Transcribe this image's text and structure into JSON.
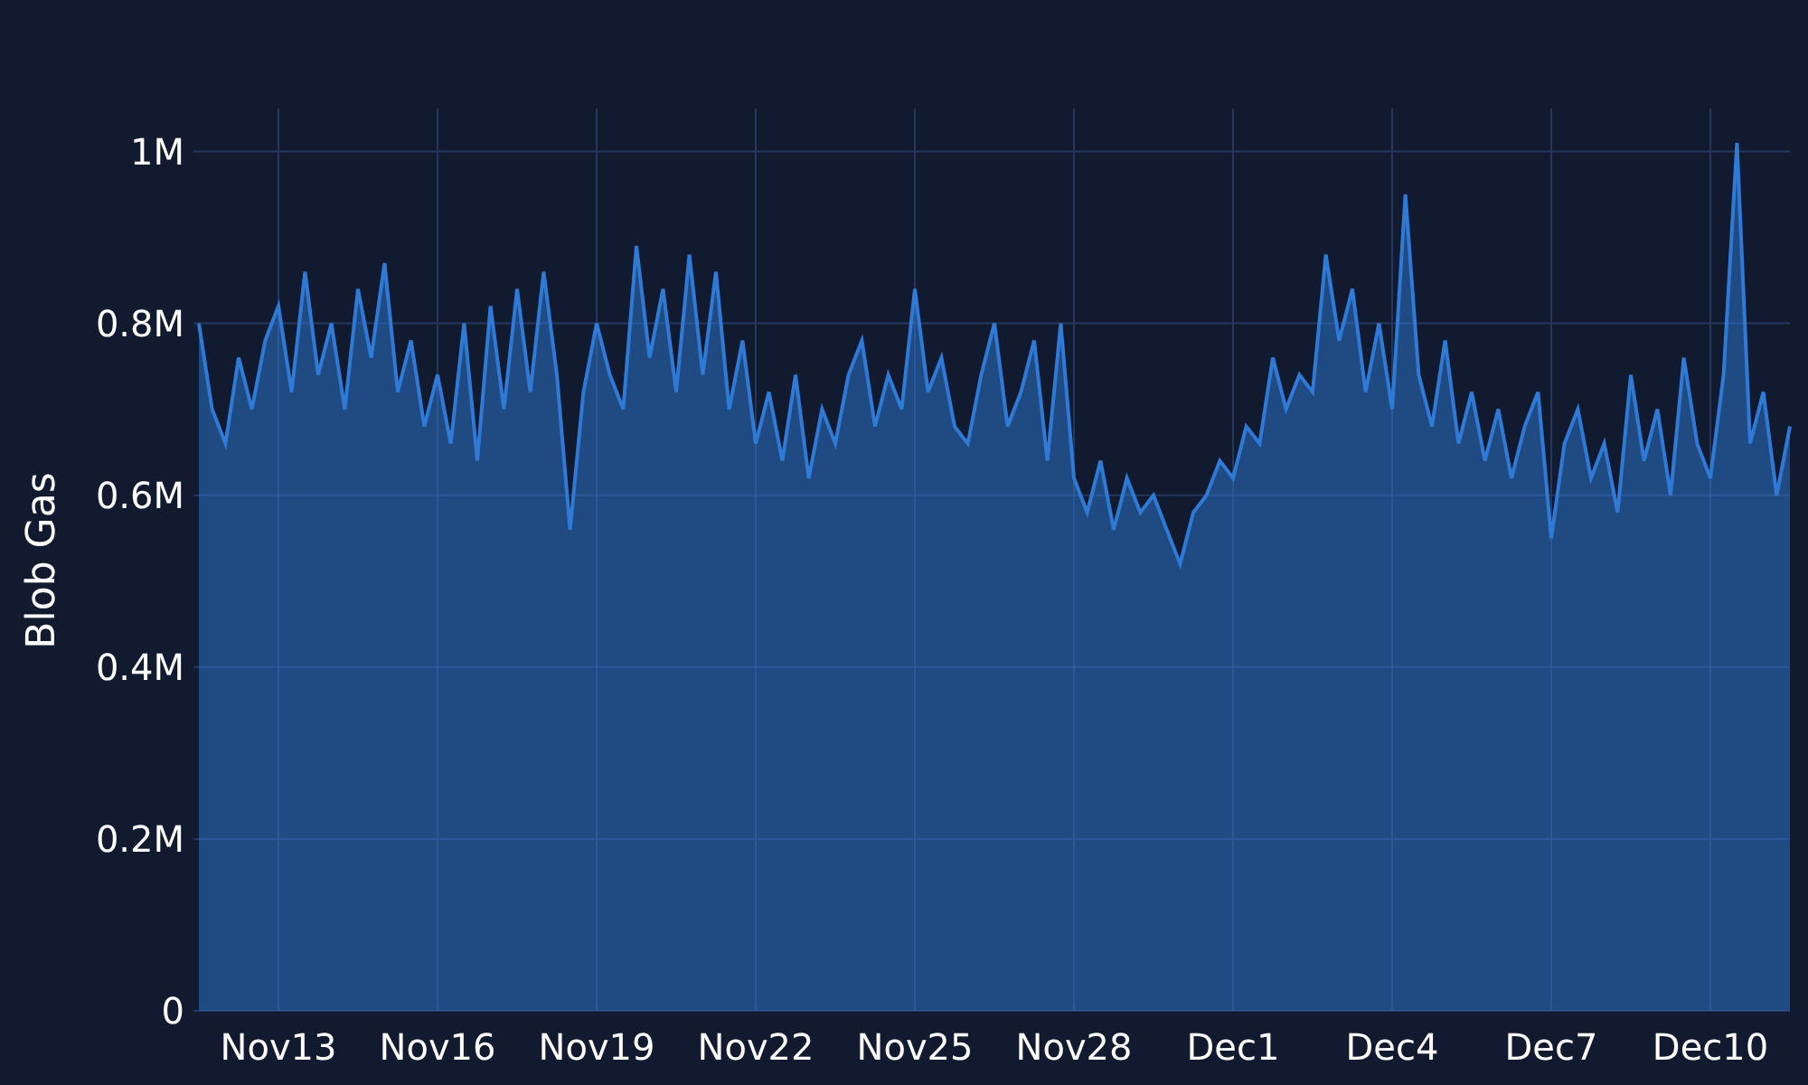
{
  "chart": {
    "chart_data": {
      "type": "area",
      "ylabel": "Blob Gas",
      "categories": [
        null,
        null,
        null,
        null,
        null,
        null,
        "Nov13",
        null,
        null,
        null,
        null,
        null,
        null,
        null,
        null,
        null,
        null,
        null,
        "Nov16",
        null,
        null,
        null,
        null,
        null,
        null,
        null,
        null,
        null,
        null,
        null,
        "Nov19",
        null,
        null,
        null,
        null,
        null,
        null,
        null,
        null,
        null,
        null,
        null,
        "Nov22",
        null,
        null,
        null,
        null,
        null,
        null,
        null,
        null,
        null,
        null,
        null,
        "Nov25",
        null,
        null,
        null,
        null,
        null,
        null,
        null,
        null,
        null,
        null,
        null,
        "Nov28",
        null,
        null,
        null,
        null,
        null,
        null,
        null,
        null,
        null,
        null,
        null,
        "Dec1",
        null,
        null,
        null,
        null,
        null,
        null,
        null,
        null,
        null,
        null,
        null,
        "Dec4",
        null,
        null,
        null,
        null,
        null,
        null,
        null,
        null,
        null,
        null,
        null,
        "Dec7",
        null,
        null,
        null,
        null,
        null,
        null,
        null,
        null,
        null,
        null,
        null,
        "Dec10",
        null,
        null,
        null,
        null,
        null,
        null
      ],
      "grid": true,
      "series": [
        {
          "color": "#2f7ad6",
          "values": [
            0.8,
            0.7,
            0.66,
            0.76,
            0.7,
            0.78,
            0.82,
            0.72,
            0.86,
            0.74,
            0.8,
            0.7,
            0.84,
            0.76,
            0.87,
            0.72,
            0.78,
            0.68,
            0.74,
            0.66,
            0.8,
            0.64,
            0.82,
            0.7,
            0.84,
            0.72,
            0.86,
            0.74,
            0.56,
            0.72,
            0.8,
            0.74,
            0.7,
            0.89,
            0.76,
            0.84,
            0.72,
            0.88,
            0.74,
            0.86,
            0.7,
            0.78,
            0.66,
            0.72,
            0.64,
            0.74,
            0.62,
            0.7,
            0.66,
            0.74,
            0.78,
            0.68,
            0.74,
            0.7,
            0.84,
            0.72,
            0.76,
            0.68,
            0.66,
            0.74,
            0.8,
            0.68,
            0.72,
            0.78,
            0.64,
            0.8,
            0.62,
            0.58,
            0.64,
            0.56,
            0.62,
            0.58,
            0.6,
            0.56,
            0.52,
            0.58,
            0.6,
            0.64,
            0.62,
            0.68,
            0.66,
            0.76,
            0.7,
            0.74,
            0.72,
            0.88,
            0.78,
            0.84,
            0.72,
            0.8,
            0.7,
            0.95,
            0.74,
            0.68,
            0.78,
            0.66,
            0.72,
            0.64,
            0.7,
            0.62,
            0.68,
            0.72,
            0.55,
            0.66,
            0.7,
            0.62,
            0.66,
            0.58,
            0.74,
            0.64,
            0.7,
            0.6,
            0.76,
            0.66,
            0.62,
            0.74,
            1.01,
            0.66,
            0.72,
            0.6,
            0.68
          ]
        }
      ],
      "ylim": [
        0,
        1.05
      ],
      "yticks": [
        {
          "value": 0,
          "label": "0"
        },
        {
          "value": 0.2,
          "label": "0.2M"
        },
        {
          "value": 0.4,
          "label": "0.4M"
        },
        {
          "value": 0.6,
          "label": "0.6M"
        },
        {
          "value": 0.8,
          "label": "0.8M"
        },
        {
          "value": 1,
          "label": "1M"
        }
      ]
    }
  }
}
